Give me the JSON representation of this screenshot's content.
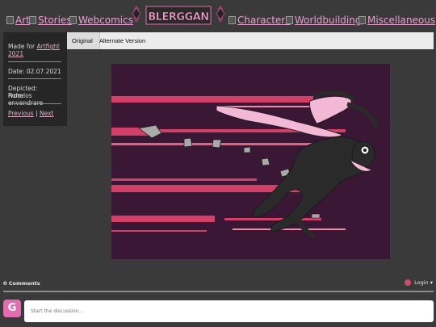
{
  "nav": {
    "left": [
      {
        "label": "Art"
      },
      {
        "label": "Stories"
      },
      {
        "label": "Webcomics"
      }
    ],
    "right": [
      {
        "label": "Characters"
      },
      {
        "label": "Worldbuilding"
      },
      {
        "label": "Miscellaneous"
      }
    ],
    "logo_text": "BLERGGAN"
  },
  "sidebar": {
    "made_for_prefix": "Made for",
    "made_for_link": "Artfight 2021",
    "date": "Date: 02.07.2021",
    "depicted": "Depicted: Ruhelos",
    "from": "From: envandrare",
    "previous": "Previous",
    "separator": "|",
    "next": "Next"
  },
  "tabs": [
    {
      "label": "Original",
      "active": true
    },
    {
      "label": "Alternate Version",
      "active": false
    }
  ],
  "comments": {
    "count_label": "0 Comments",
    "login_label": "Login ▾",
    "avatar_letter": "G",
    "placeholder": "Start the discussion..."
  },
  "colors": {
    "background": "#3a3a3a",
    "link": "#e8a0d0",
    "accent": "#e06db0",
    "art_background": "#3a1735",
    "stripe": "#d43f68"
  }
}
